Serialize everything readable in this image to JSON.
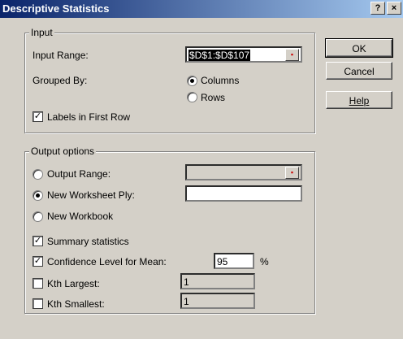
{
  "window": {
    "title": "Descriptive Statistics",
    "help_glyph": "?",
    "close_glyph": "×"
  },
  "buttons": {
    "ok": "OK",
    "cancel": "Cancel",
    "help": "Help"
  },
  "input": {
    "legend": "Input",
    "range_label": "Input Range:",
    "range_value": "$D$1:$D$107",
    "grouped_label": "Grouped By:",
    "columns_label": "Columns",
    "rows_label": "Rows",
    "grouped_selected": "Columns",
    "labels_label": "Labels in First Row",
    "labels_checked": true
  },
  "output": {
    "legend": "Output options",
    "output_range_label": "Output Range:",
    "output_range_value": "",
    "worksheet_label": "New Worksheet Ply:",
    "worksheet_value": "",
    "workbook_label": "New Workbook",
    "selected": "New Worksheet Ply:",
    "summary_label": "Summary statistics",
    "summary_checked": true,
    "confidence_label": "Confidence Level for Mean:",
    "confidence_value": "95",
    "confidence_unit": "%",
    "confidence_checked": true,
    "kth_largest_label": "Kth Largest:",
    "kth_largest_value": "1",
    "kth_largest_checked": false,
    "kth_smallest_label": "Kth Smallest:",
    "kth_smallest_value": "1",
    "kth_smallest_checked": false
  },
  "icons": {
    "ref_button": "collapse-dialog-icon",
    "checkmark": "checkmark-icon"
  }
}
